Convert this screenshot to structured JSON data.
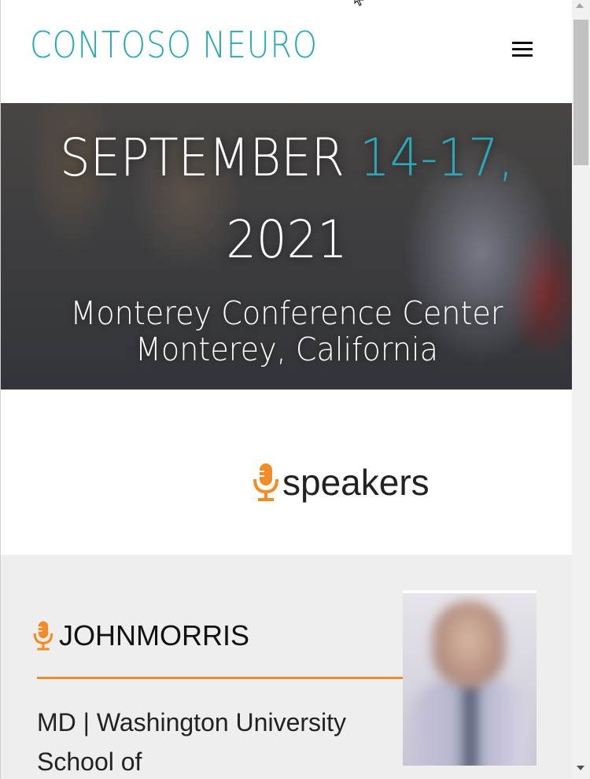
{
  "header": {
    "logo_text": "CONTOSO NEURO",
    "menu_icon": "hamburger-menu-icon"
  },
  "hero": {
    "date_main": "SEPTEMBER ",
    "date_accent": "14-17,",
    "date_year": "2021",
    "venue_line1": "Monterey Conference Center",
    "venue_line2": "Monterey, California"
  },
  "speakers_section": {
    "heading": "speakers",
    "icon": "microphone-icon"
  },
  "speaker": {
    "name": "JOHNMORRIS",
    "affiliation": "MD | Washington University School of",
    "icon": "microphone-icon",
    "photo": "speaker-photo"
  },
  "colors": {
    "brand_teal": "#2aaab8",
    "accent_orange": "#f28c28",
    "card_background": "#eeeeee"
  }
}
